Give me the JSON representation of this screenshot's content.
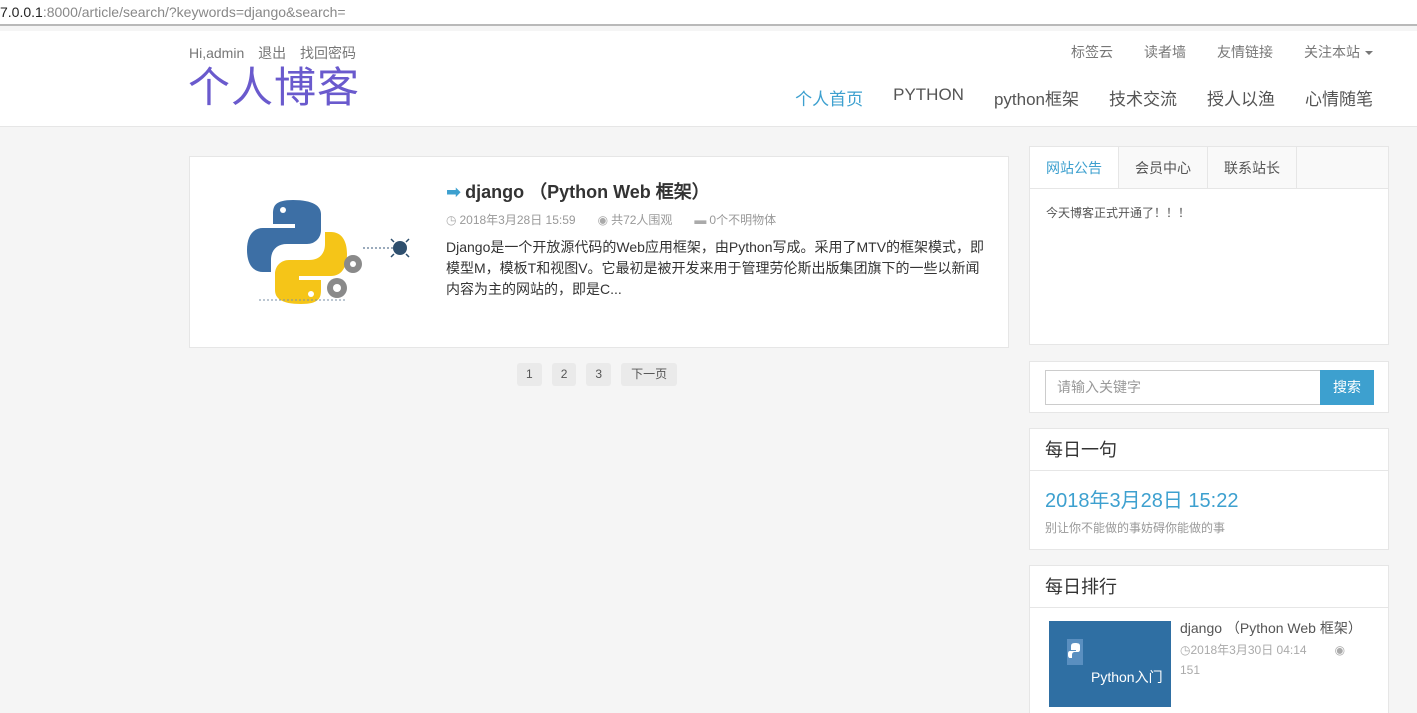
{
  "urlbar": {
    "host": "7.0.0.1",
    "rest": ":8000/article/search/?keywords=django&search="
  },
  "header": {
    "user_greeting": "Hi,admin",
    "logout": "退出",
    "find_password": "找回密码",
    "logo": "个人博客",
    "top_links": [
      "标签云",
      "读者墙",
      "友情链接",
      "关注本站"
    ],
    "nav": [
      "个人首页",
      "PYTHON",
      "python框架",
      "技术交流",
      "授人以渔",
      "心情随笔"
    ]
  },
  "article": {
    "title": "django （Python Web 框架）",
    "date": "2018年3月28日 15:59",
    "views": "共72人围观",
    "comments": "0个不明物体",
    "excerpt": "Django是一个开放源代码的Web应用框架，由Python写成。采用了MTV的框架模式，即模型M，模板T和视图V。它最初是被开发来用于管理劳伦斯出版集团旗下的一些以新闻内容为主的网站的，即是C..."
  },
  "pager": {
    "pages": [
      "1",
      "2",
      "3"
    ],
    "next": "下一页"
  },
  "sidebar": {
    "tabs": [
      "网站公告",
      "会员中心",
      "联系站长"
    ],
    "notice": "今天博客正式开通了！！！",
    "search_placeholder": "请输入关键字",
    "search_button": "搜索",
    "daily_title": "每日一句",
    "daily_time": "2018年3月28日 15:22",
    "daily_quote": "别让你不能做的事妨碍你能做的事",
    "rank_title": "每日排行",
    "rank_item": {
      "title": "django （Python Web 框架）",
      "date": "2018年3月30日 04:14",
      "views": "151",
      "thumb_label": "Python入门"
    }
  },
  "colors": {
    "accent": "#3da0cf",
    "logo": "#6a5acd"
  }
}
